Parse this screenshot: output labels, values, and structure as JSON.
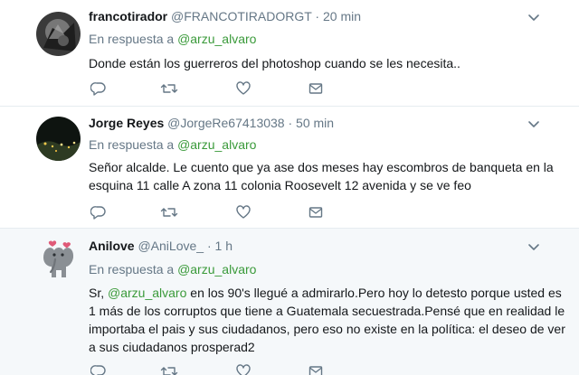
{
  "colors": {
    "text": "#14171a",
    "secondary": "#657786",
    "mention": "#3a9a3a",
    "border": "#e6ecf0",
    "highlight_bg": "#f5f8fa"
  },
  "tweets": [
    {
      "fullname": "francotirador",
      "username": "@FRANCOTIRADORGT",
      "separator": "·",
      "time": "20 min",
      "reply_prefix": "En respuesta a",
      "reply_to": "@arzu_alvaro",
      "text": "Donde están los guerreros del photoshop cuando se les necesita..",
      "icons": [
        "reply-icon",
        "retweet-icon",
        "like-icon",
        "direct-message-icon",
        "chevron-down-icon"
      ]
    },
    {
      "fullname": "Jorge Reyes",
      "username": "@JorgeRe67413038",
      "separator": "·",
      "time": "50 min",
      "reply_prefix": "En respuesta a",
      "reply_to": "@arzu_alvaro",
      "text": "Señor alcalde.  Le cuento que ya ase dos meses hay escombros de banqueta en la esquina 11 calle A zona 11 colonia Roosevelt 12 avenida y se ve feo",
      "icons": [
        "reply-icon",
        "retweet-icon",
        "like-icon",
        "direct-message-icon",
        "chevron-down-icon"
      ]
    },
    {
      "fullname": "Anilove",
      "username": "@AniLove_",
      "separator": "·",
      "time": "1 h",
      "reply_prefix": "En respuesta a",
      "reply_to": "@arzu_alvaro",
      "text_prefix": "Sr, ",
      "text_mention": "@arzu_alvaro",
      "text_rest": " en los 90's llegué a admirarlo.Pero hoy lo detesto porque usted es 1 más de los corruptos que tiene a Guatemala secuestrada.Pensé que en realidad le importaba el pais y sus ciudadanos, pero eso no existe en la política: el deseo de ver a sus ciudadanos prosperad2",
      "icons": [
        "reply-icon",
        "retweet-icon",
        "like-icon",
        "direct-message-icon",
        "chevron-down-icon"
      ]
    }
  ]
}
